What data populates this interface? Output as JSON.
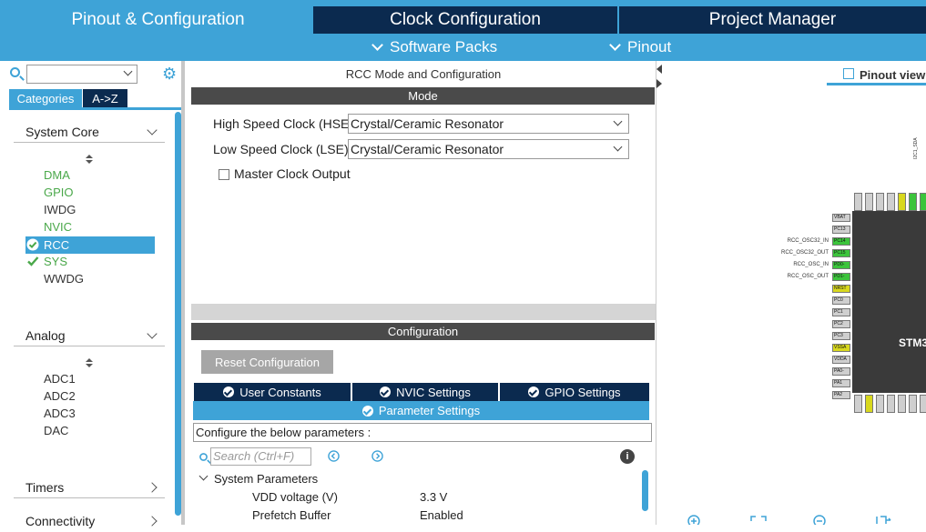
{
  "tabs": {
    "pinout": "Pinout & Configuration",
    "clock": "Clock Configuration",
    "project": "Project Manager"
  },
  "subtabs": {
    "software_packs": "Software Packs",
    "pinout": "Pinout"
  },
  "left": {
    "categories_tab": "Categories",
    "az_tab": "A->Z",
    "sections": [
      {
        "label": "System Core",
        "items": [
          "DMA",
          "GPIO",
          "IWDG",
          "NVIC",
          "RCC",
          "SYS",
          "WWDG"
        ]
      },
      {
        "label": "Analog",
        "items": [
          "ADC1",
          "ADC2",
          "ADC3",
          "DAC"
        ]
      },
      {
        "label": "Timers"
      },
      {
        "label": "Connectivity"
      }
    ]
  },
  "mode": {
    "title": "RCC Mode and Configuration",
    "header": "Mode",
    "hse_label": "High Speed Clock (HSE)",
    "hse_value": "Crystal/Ceramic Resonator",
    "lse_label": "Low Speed Clock (LSE)",
    "lse_value": "Crystal/Ceramic Resonator",
    "mco_label": "Master Clock Output"
  },
  "config": {
    "header": "Configuration",
    "reset_button": "Reset Configuration",
    "tabs": [
      "User Constants",
      "NVIC Settings",
      "GPIO Settings"
    ],
    "active_tab": "Parameter Settings",
    "info_text": "Configure the below parameters :",
    "search_placeholder": "Search (Ctrl+F)",
    "group": "System Parameters",
    "params": [
      {
        "name": "VDD voltage (V)",
        "value": "3.3 V"
      },
      {
        "name": "Prefetch Buffer",
        "value": "Enabled"
      }
    ]
  },
  "right": {
    "view_label": "Pinout view",
    "chip_label": "STM3",
    "pins_left": [
      "VBAT",
      "PC13",
      "PC14",
      "PC15",
      "PD0-",
      "PD1-",
      "NRST",
      "PC0",
      "PC1",
      "PC2",
      "PC3",
      "VSSA",
      "VDDA",
      "PA0-",
      "PA1",
      "PA2"
    ],
    "pin_labels": [
      "RCC_OSC32_IN",
      "RCC_OSC32_OUT",
      "RCC_OSC_IN",
      "RCC_OSC_OUT"
    ],
    "top_label": "I2C1_SDA"
  },
  "colors": {
    "accent": "#3ea3d7",
    "navy": "#0b2a4f",
    "green": "#4aa84a",
    "pin_green": "#3cc43c",
    "pin_yellow": "#d8d81e"
  }
}
